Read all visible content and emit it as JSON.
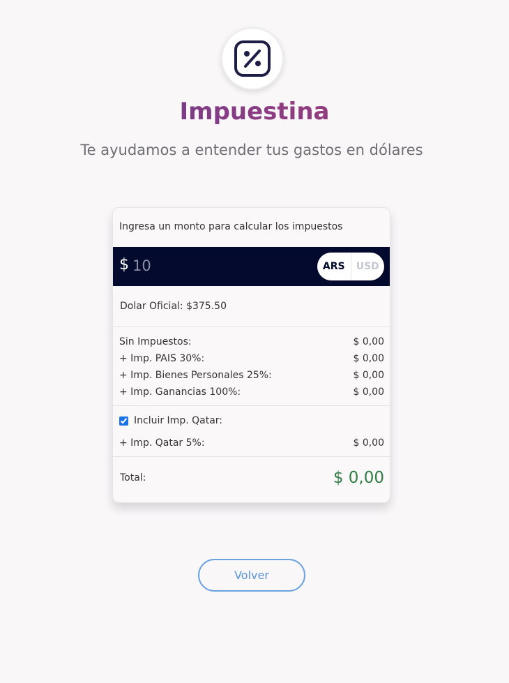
{
  "header": {
    "logo_icon": "percent-icon",
    "title": "Impuestina",
    "subtitle": "Te ayudamos a entender tus gastos en dólares",
    "title_gradient": [
      "#5b3f8f",
      "#a43a6f"
    ]
  },
  "calculator": {
    "prompt": "Ingresa un monto para calcular los impuestos",
    "currency_symbol": "$",
    "amount_value": "",
    "amount_placeholder": "10",
    "currency_options": [
      "ARS",
      "USD"
    ],
    "selected_currency": "ARS",
    "official_rate_text": "Dolar Oficial: $375.50",
    "lines": [
      {
        "label": "Sin Impuestos:",
        "value": "$ 0,00"
      },
      {
        "label": "+ Imp. PAIS 30%:",
        "value": "$ 0,00"
      },
      {
        "label": "+ Imp. Bienes Personales 25%:",
        "value": "$ 0,00"
      },
      {
        "label": "+ Imp. Ganancias 100%:",
        "value": "$ 0,00"
      }
    ],
    "qatar": {
      "checkbox_label": "Incluir Imp. Qatar:",
      "checked": true,
      "line_label": "+ Imp. Qatar 5%:",
      "line_value": "$ 0,00"
    },
    "total_label": "Total:",
    "total_value": "$ 0,00"
  },
  "footer": {
    "back_label": "Volver"
  },
  "colors": {
    "amount_bar": "#040a2e",
    "total": "#2f7d45",
    "back_button": "#5a93d6"
  }
}
